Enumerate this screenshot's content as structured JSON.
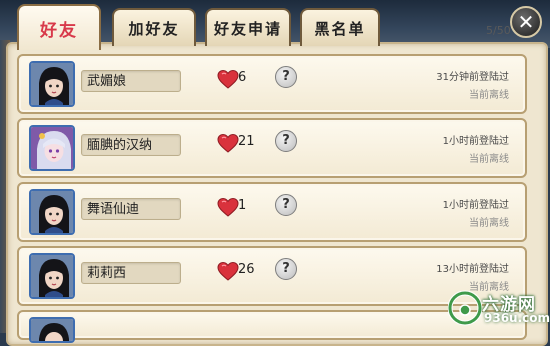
{
  "tabs": [
    {
      "label": "好友",
      "active": true
    },
    {
      "label": "加好友",
      "active": false
    },
    {
      "label": "好友申请",
      "active": false
    },
    {
      "label": "黑名单",
      "active": false
    }
  ],
  "counter": "5/50",
  "close_label": "✕",
  "help_glyph": "?",
  "friends": [
    {
      "name": "武媚娘",
      "hearts": "6",
      "last_login": "31分钟前登陆过",
      "status": "当前离线",
      "avatar": "female-warrior-avatar"
    },
    {
      "name": "腼腆的汉纳",
      "hearts": "21",
      "last_login": "1小时前登陆过",
      "status": "当前离线",
      "avatar": "silver-hair-girl-avatar"
    },
    {
      "name": "舞语仙迪",
      "hearts": "1",
      "last_login": "1小时前登陆过",
      "status": "当前离线",
      "avatar": "female-warrior-avatar"
    },
    {
      "name": "莉莉西",
      "hearts": "26",
      "last_login": "13小时前登陆过",
      "status": "当前离线",
      "avatar": "female-warrior-avatar"
    }
  ],
  "watermark": {
    "brand": "六游网",
    "url": "936u.com"
  },
  "colors": {
    "active_tab_text": "#d8394a",
    "heart": "#d9323c",
    "panel_bg": "#efe6d0"
  }
}
